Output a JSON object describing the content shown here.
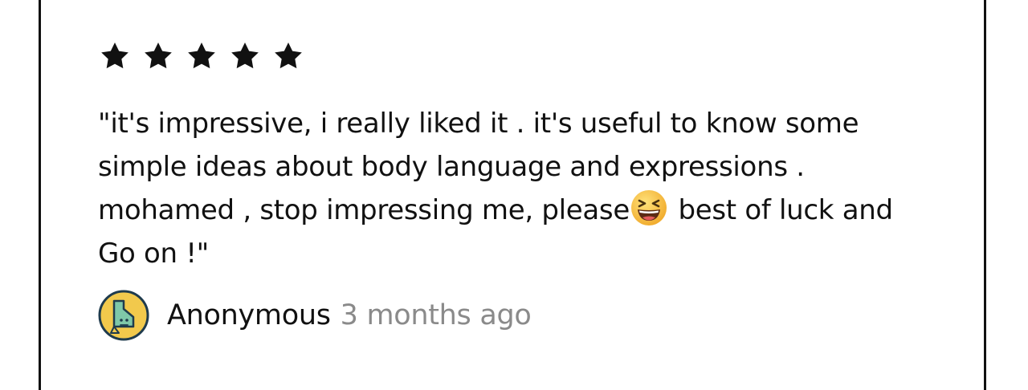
{
  "review": {
    "rating": 5,
    "rating_max": 5,
    "text_before_emoji": "\"it's impressive, i really liked it . it's useful to know some simple ideas about body language and expressions . mohamed , stop impressing me, please",
    "emoji_icon": "grinning-squinting-face-icon",
    "text_after_emoji": " best of luck and Go on !\"",
    "author": "Anonymous",
    "timestamp": "3 months ago",
    "avatar_icon": "anonymous-character-avatar-icon"
  },
  "colors": {
    "text": "#111111",
    "muted": "#8a8a8a",
    "star": "#111111",
    "avatar_bg": "#f2c94c",
    "avatar_ring": "#1f3b4d",
    "avatar_figure": "#7fc8a9",
    "emoji_face": "#f7c43c"
  }
}
